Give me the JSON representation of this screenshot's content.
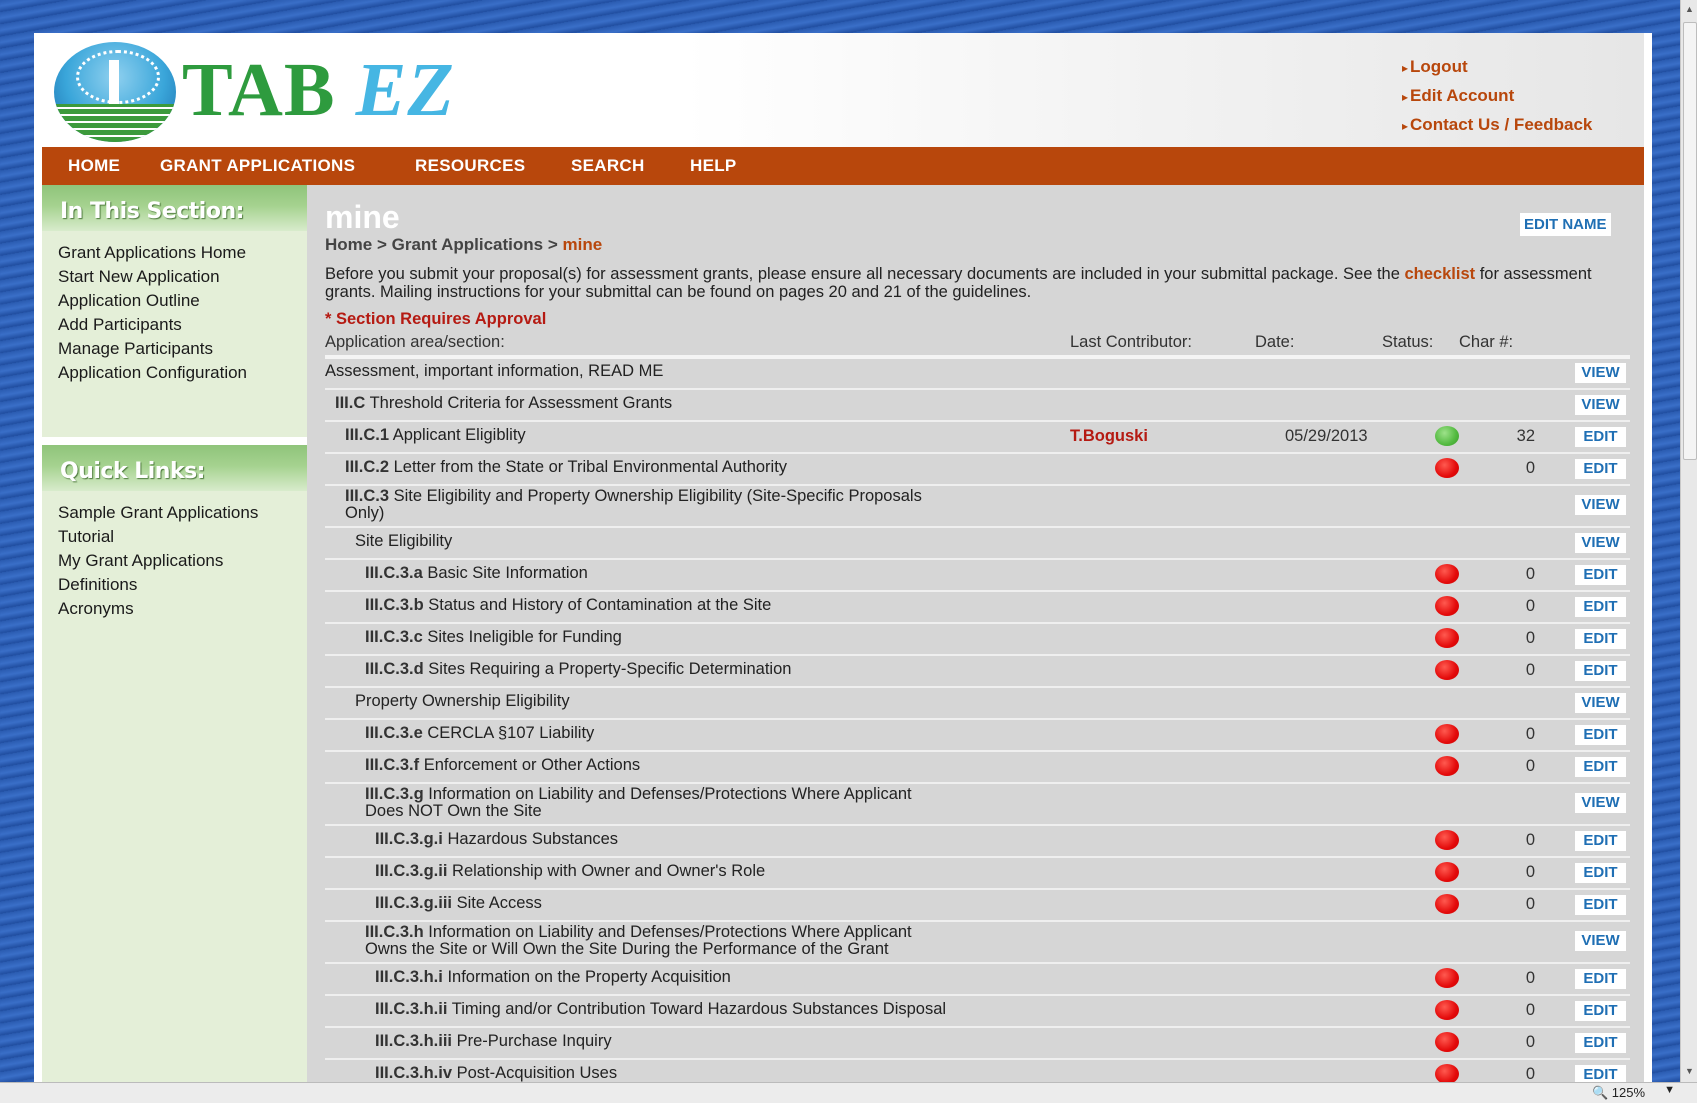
{
  "brand": {
    "name_part1": "TAB",
    "name_part2": "EZ"
  },
  "top_links": [
    "Logout",
    "Edit Account",
    "Contact Us / Feedback"
  ],
  "nav": [
    "HOME",
    "GRANT APPLICATIONS",
    "RESOURCES",
    "SEARCH",
    "HELP"
  ],
  "sidebar": {
    "section_title": "In This Section:",
    "section_items": [
      "Grant Applications Home",
      "Start New Application",
      "Application Outline",
      "Add Participants",
      "Manage Participants",
      "Application Configuration"
    ],
    "quick_title": "Quick Links:",
    "quick_items": [
      "Sample Grant Applications",
      "Tutorial",
      "My Grant Applications",
      "Definitions",
      "Acronyms"
    ]
  },
  "main": {
    "title": "mine",
    "edit_name": "EDIT NAME",
    "breadcrumb": {
      "home": "Home",
      "sep": ">",
      "section": "Grant Applications",
      "current": "mine"
    },
    "intro_before": "Before you submit your proposal(s) for assessment grants, please ensure all necessary documents are included in your submittal package. See the",
    "intro_link": "checklist",
    "intro_after": "for assessment grants. Mailing instructions for your submittal can be found on pages 20 and 21 of the guidelines.",
    "required_note": "* Section Requires Approval",
    "columns": {
      "area": "Application area/section:",
      "contributor": "Last Contributor:",
      "date": "Date:",
      "status": "Status:",
      "chars": "Char #:"
    }
  },
  "rows": [
    {
      "code": "",
      "label": "Assessment, important information, READ ME",
      "contributor": "",
      "date": "",
      "status": "",
      "chars": "",
      "action": "VIEW"
    },
    {
      "code": "III.C",
      "label": "Threshold Criteria for Assessment Grants",
      "contributor": "",
      "date": "",
      "status": "",
      "chars": "",
      "action": "VIEW"
    },
    {
      "code": "III.C.1",
      "label": "Applicant Eligiblity",
      "contributor": "T.Boguski",
      "date": "05/29/2013",
      "status": "green",
      "chars": "32",
      "action": "EDIT"
    },
    {
      "code": "III.C.2",
      "label": "Letter from the State or Tribal Environmental Authority",
      "contributor": "",
      "date": "",
      "status": "red",
      "chars": "0",
      "action": "EDIT"
    },
    {
      "code": "III.C.3",
      "label": "Site Eligibility and Property Ownership Eligibility (Site-Specific Proposals",
      "label2": "Only)",
      "contributor": "",
      "date": "",
      "status": "",
      "chars": "",
      "action": "VIEW"
    },
    {
      "code": "",
      "label": "Site Eligibility",
      "contributor": "",
      "date": "",
      "status": "",
      "chars": "",
      "action": "VIEW"
    },
    {
      "code": "III.C.3.a",
      "label": "Basic Site Information",
      "contributor": "",
      "date": "",
      "status": "red",
      "chars": "0",
      "action": "EDIT"
    },
    {
      "code": "III.C.3.b",
      "label": "Status and History of Contamination at the Site",
      "contributor": "",
      "date": "",
      "status": "red",
      "chars": "0",
      "action": "EDIT"
    },
    {
      "code": "III.C.3.c",
      "label": "Sites Ineligible for Funding",
      "contributor": "",
      "date": "",
      "status": "red",
      "chars": "0",
      "action": "EDIT"
    },
    {
      "code": "III.C.3.d",
      "label": "Sites Requiring a Property-Specific Determination",
      "contributor": "",
      "date": "",
      "status": "red",
      "chars": "0",
      "action": "EDIT"
    },
    {
      "code": "",
      "label": "Property Ownership Eligibility",
      "contributor": "",
      "date": "",
      "status": "",
      "chars": "",
      "action": "VIEW"
    },
    {
      "code": "III.C.3.e",
      "label": "CERCLA §107 Liability",
      "contributor": "",
      "date": "",
      "status": "red",
      "chars": "0",
      "action": "EDIT"
    },
    {
      "code": "III.C.3.f",
      "label": "Enforcement or Other Actions",
      "contributor": "",
      "date": "",
      "status": "red",
      "chars": "0",
      "action": "EDIT"
    },
    {
      "code": "III.C.3.g",
      "label": "Information on Liability and Defenses/Protections Where Applicant",
      "label2": "Does NOT Own the Site",
      "contributor": "",
      "date": "",
      "status": "",
      "chars": "",
      "action": "VIEW"
    },
    {
      "code": "III.C.3.g.i",
      "label": "Hazardous Substances",
      "contributor": "",
      "date": "",
      "status": "red",
      "chars": "0",
      "action": "EDIT"
    },
    {
      "code": "III.C.3.g.ii",
      "label": "Relationship with Owner and Owner's Role",
      "contributor": "",
      "date": "",
      "status": "red",
      "chars": "0",
      "action": "EDIT"
    },
    {
      "code": "III.C.3.g.iii",
      "label": "Site Access",
      "contributor": "",
      "date": "",
      "status": "red",
      "chars": "0",
      "action": "EDIT"
    },
    {
      "code": "III.C.3.h",
      "label": "Information on Liability and Defenses/Protections Where Applicant",
      "label2": "Owns the Site or Will Own the Site During the Performance of the Grant",
      "contributor": "",
      "date": "",
      "status": "",
      "chars": "",
      "action": "VIEW"
    },
    {
      "code": "III.C.3.h.i",
      "label": "Information on the Property Acquisition",
      "contributor": "",
      "date": "",
      "status": "red",
      "chars": "0",
      "action": "EDIT"
    },
    {
      "code": "III.C.3.h.ii",
      "label": "Timing and/or Contribution Toward Hazardous Substances Disposal",
      "contributor": "",
      "date": "",
      "status": "red",
      "chars": "0",
      "action": "EDIT"
    },
    {
      "code": "III.C.3.h.iii",
      "label": "Pre-Purchase Inquiry",
      "contributor": "",
      "date": "",
      "status": "red",
      "chars": "0",
      "action": "EDIT"
    },
    {
      "code": "III.C.3.h.iv",
      "label": "Post-Acquisition Uses",
      "contributor": "",
      "date": "",
      "status": "red",
      "chars": "0",
      "action": "EDIT"
    }
  ],
  "statusbar": {
    "zoom": "125%"
  },
  "colors": {
    "accent": "#b8470c",
    "link_blue": "#1f6fb4",
    "status_red": "#e30a0a",
    "status_green": "#52b93f"
  }
}
